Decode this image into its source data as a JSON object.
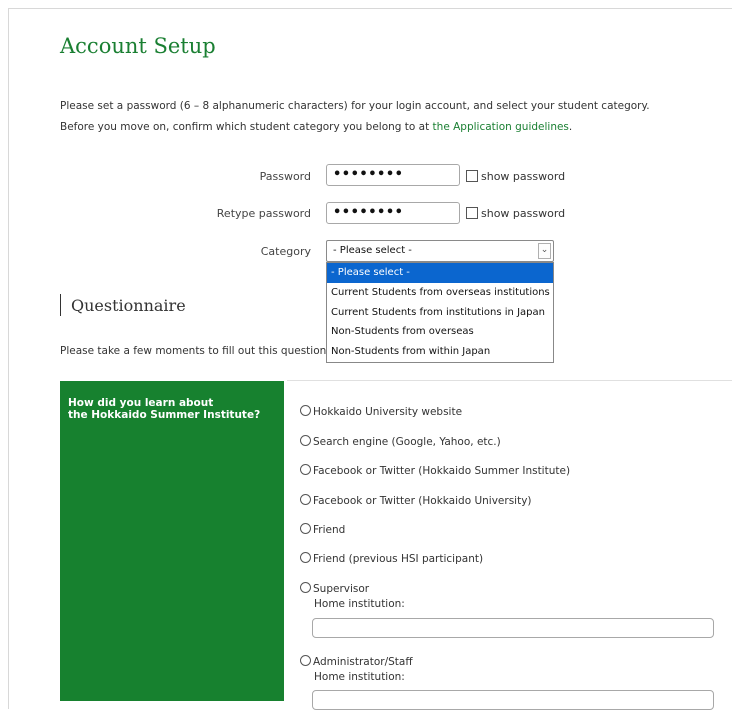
{
  "account": {
    "title": "Account Setup",
    "intro_line1": "Please set a password (6 – 8 alphanumeric characters) for your login account, and select your student category.",
    "intro_line2_pre": "Before you move on, confirm which student category you belong to at ",
    "intro_link": "the Application guidelines",
    "intro_line2_post": "."
  },
  "form": {
    "password_label": "Password",
    "password_value": "••••••••",
    "retype_label": "Retype password",
    "retype_value": "••••••••",
    "show_password_label": "show password",
    "category_label": "Category",
    "category_selected": "- Please select -",
    "category_options": [
      "- Please select -",
      "Current Students from overseas institutions",
      "Current Students from institutions in Japan",
      "Non-Students from overseas",
      "Non-Students from within Japan"
    ]
  },
  "questionnaire": {
    "title": "Questionnaire",
    "text": "Please take a few moments to fill out this questionnai",
    "question_line1": "How did you learn about",
    "question_line2": "the Hokkaido Summer Institute?",
    "options": [
      "Hokkaido University website",
      "Search engine (Google, Yahoo, etc.)",
      "Facebook or Twitter (Hokkaido Summer Institute)",
      "Facebook or Twitter (Hokkaido University)",
      "Friend",
      "Friend (previous HSI participant)",
      "Supervisor",
      "Administrator/Staff"
    ],
    "home_institution_label": "Home institution:"
  },
  "colors": {
    "accent_green": "#1a7f32",
    "panel_green": "#17812f",
    "selected_blue": "#0b66cf"
  }
}
